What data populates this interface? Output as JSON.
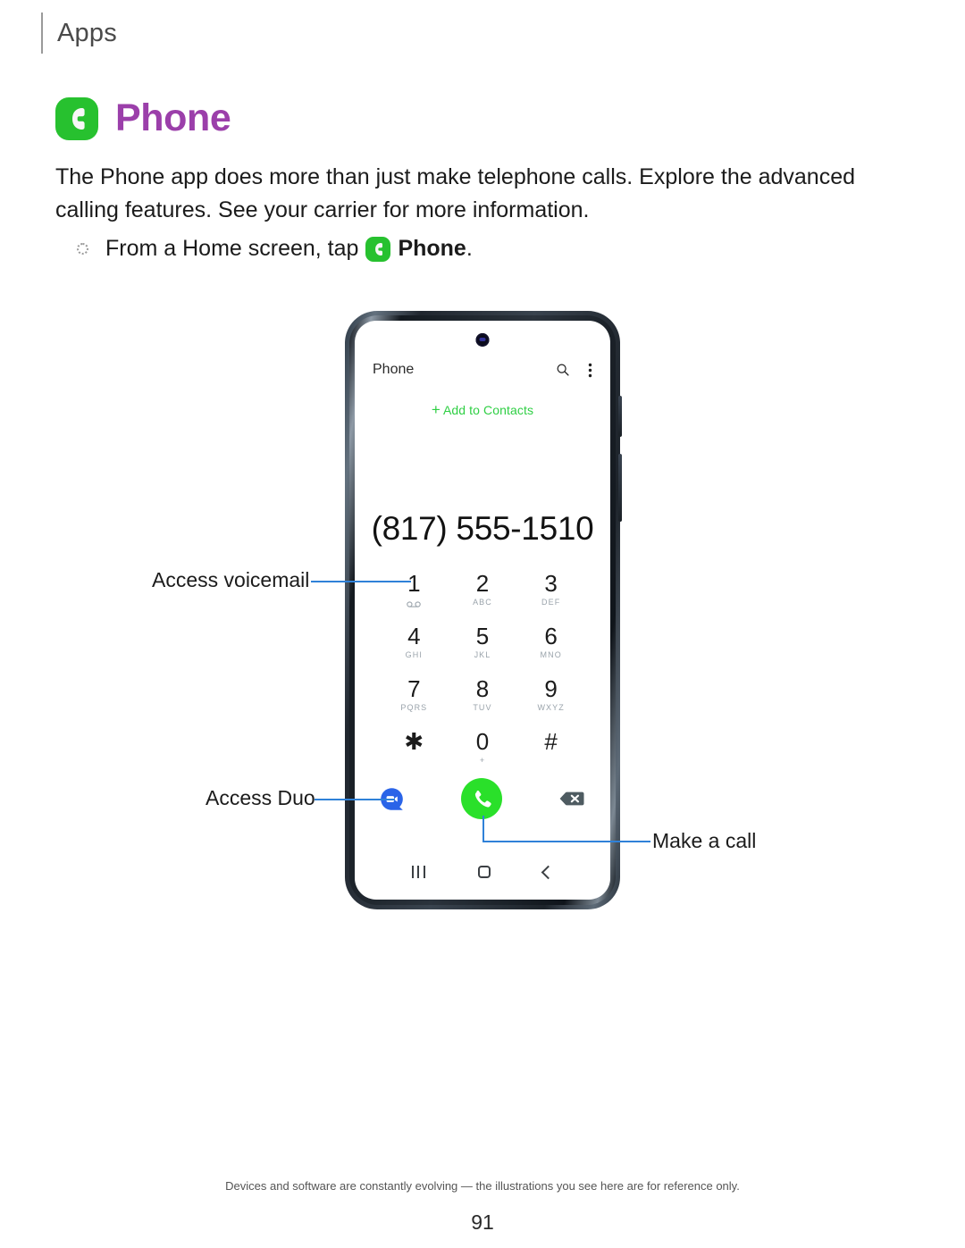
{
  "running_head": {
    "label": "Apps"
  },
  "section": {
    "title": "Phone",
    "icon": "phone-app-icon",
    "title_color": "#9b3faa",
    "icon_color": "#27c12f"
  },
  "body": {
    "paragraph": "The Phone app does more than just make telephone calls. Explore the advanced calling features. See your carrier for more information."
  },
  "step": {
    "bullet_icon": "dotted-circle-bullet",
    "text_before": "From a Home screen, tap",
    "inline_icon": "phone-app-icon",
    "app_name": "Phone",
    "text_after": "."
  },
  "device": {
    "screen": {
      "camera": "front-camera-punch-hole",
      "appbar": {
        "title": "Phone",
        "search_icon": "search-icon",
        "overflow_icon": "more-vertical-icon"
      },
      "add_to_contacts": {
        "plus": "+",
        "label": "Add to Contacts",
        "color": "#2fcf44"
      },
      "number_display": "(817) 555-1510",
      "keypad": [
        {
          "digit": "1",
          "letters": "",
          "icon": "voicemail-icon"
        },
        {
          "digit": "2",
          "letters": "ABC",
          "icon": ""
        },
        {
          "digit": "3",
          "letters": "DEF",
          "icon": ""
        },
        {
          "digit": "4",
          "letters": "GHI",
          "icon": ""
        },
        {
          "digit": "5",
          "letters": "JKL",
          "icon": ""
        },
        {
          "digit": "6",
          "letters": "MNO",
          "icon": ""
        },
        {
          "digit": "7",
          "letters": "PQRS",
          "icon": ""
        },
        {
          "digit": "8",
          "letters": "TUV",
          "icon": ""
        },
        {
          "digit": "9",
          "letters": "WXYZ",
          "icon": ""
        },
        {
          "digit": "✱",
          "letters": "",
          "icon": ""
        },
        {
          "digit": "0",
          "letters": "+",
          "icon": ""
        },
        {
          "digit": "#",
          "letters": "",
          "icon": ""
        }
      ],
      "actions": {
        "duo_icon": "duo-video-call-icon",
        "duo_color": "#2a64e8",
        "call_icon": "call-handset-icon",
        "call_color": "#2ae02a",
        "backspace_icon": "backspace-delete-icon",
        "backspace_color": "#4e5b61"
      },
      "navbar": {
        "recents_icon": "recents-icon",
        "home_icon": "home-icon",
        "back_icon": "back-icon"
      }
    }
  },
  "callouts": [
    {
      "id": "voicemail",
      "label": "Access voicemail",
      "target": "keypad-key-1",
      "line_color": "#2f81d8"
    },
    {
      "id": "duo",
      "label": "Access Duo",
      "target": "duo-button",
      "line_color": "#2f81d8"
    },
    {
      "id": "call",
      "label": "Make a call",
      "target": "call-button",
      "line_color": "#2f81d8"
    }
  ],
  "footer": {
    "note": "Devices and software are constantly evolving — the illustrations you see here are for reference only.",
    "page_number": "91"
  }
}
